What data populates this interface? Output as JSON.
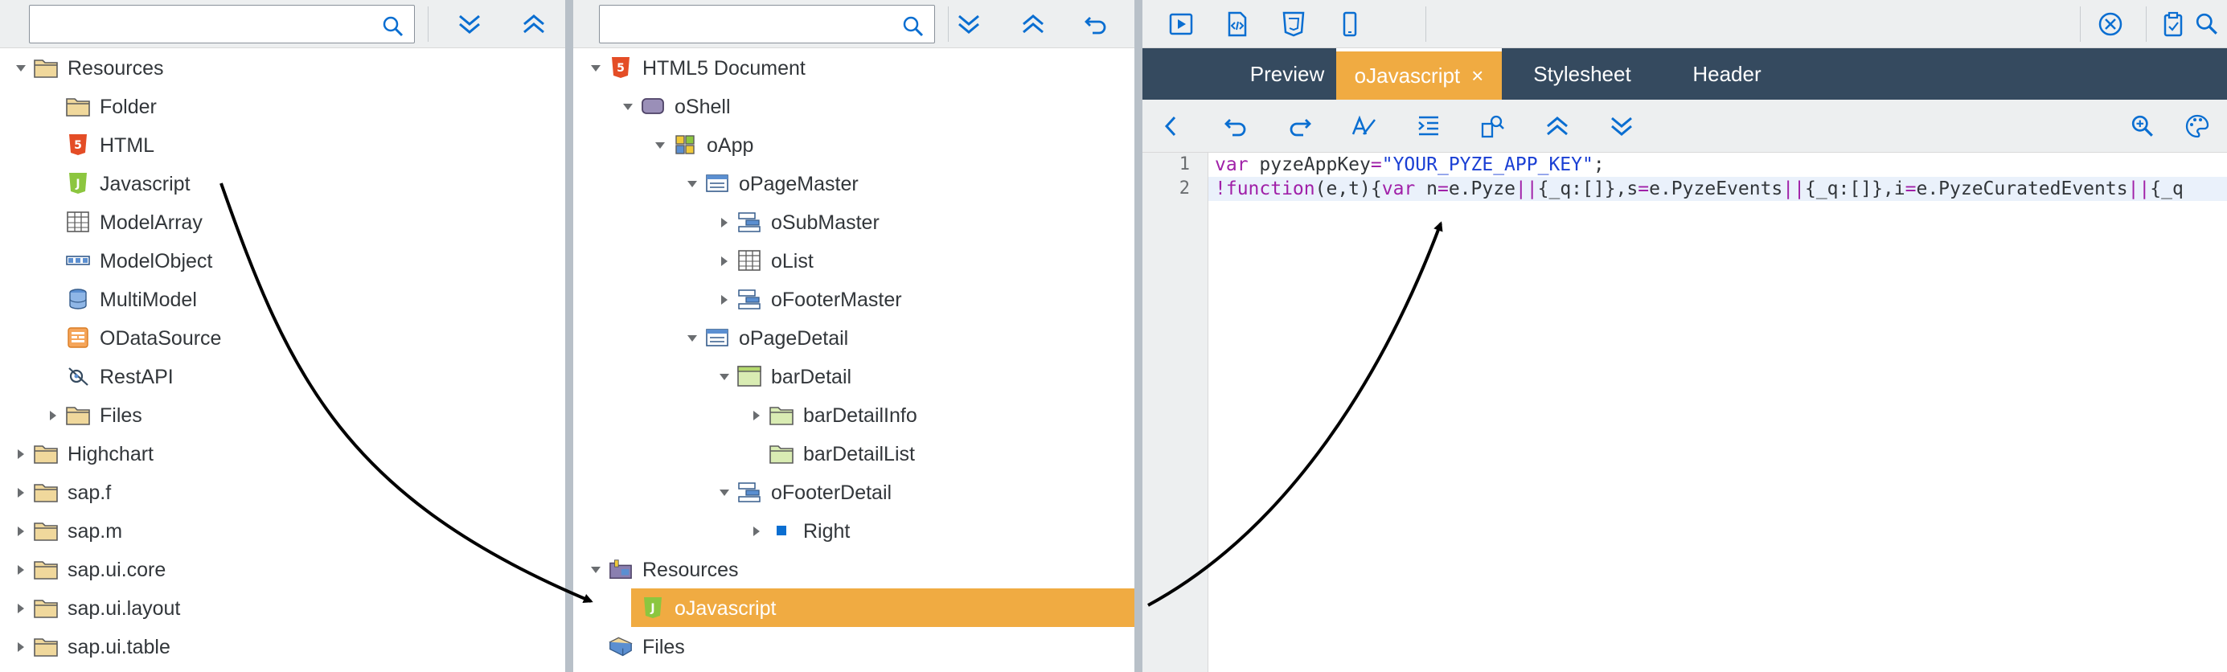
{
  "left_panel": {
    "search": {
      "value": "",
      "placeholder": ""
    },
    "toolbar": {
      "expand_all": "chevrons-down-icon",
      "collapse_all": "chevrons-up-icon"
    },
    "tree": [
      {
        "label": "Resources",
        "icon": "folder-icon",
        "expanded": true
      },
      {
        "label": "Folder",
        "icon": "folder-icon"
      },
      {
        "label": "HTML",
        "icon": "html5-icon"
      },
      {
        "label": "Javascript",
        "icon": "javascript-icon"
      },
      {
        "label": "ModelArray",
        "icon": "table-icon"
      },
      {
        "label": "ModelObject",
        "icon": "object-icon"
      },
      {
        "label": "MultiModel",
        "icon": "database-icon"
      },
      {
        "label": "ODataSource",
        "icon": "odata-icon"
      },
      {
        "label": "RestAPI",
        "icon": "api-icon"
      },
      {
        "label": "Files",
        "icon": "folder-icon",
        "expanded": false
      },
      {
        "label": "Highchart",
        "icon": "folder-icon",
        "expanded": false
      },
      {
        "label": "sap.f",
        "icon": "folder-icon",
        "expanded": false
      },
      {
        "label": "sap.m",
        "icon": "folder-icon",
        "expanded": false
      },
      {
        "label": "sap.ui.core",
        "icon": "folder-icon",
        "expanded": false
      },
      {
        "label": "sap.ui.layout",
        "icon": "folder-icon",
        "expanded": false
      },
      {
        "label": "sap.ui.table",
        "icon": "folder-icon",
        "expanded": false
      }
    ]
  },
  "middle_panel": {
    "search": {
      "value": "",
      "placeholder": ""
    },
    "toolbar": {
      "expand_all": "chevrons-down-icon",
      "collapse_all": "chevrons-up-icon",
      "undo": "undo-icon"
    },
    "tree": [
      {
        "label": "HTML5 Document",
        "icon": "html5-icon",
        "expanded": true
      },
      {
        "label": "oShell",
        "icon": "shell-icon",
        "expanded": true
      },
      {
        "label": "oApp",
        "icon": "app-icon",
        "expanded": true
      },
      {
        "label": "oPageMaster",
        "icon": "page-icon",
        "expanded": true
      },
      {
        "label": "oSubMaster",
        "icon": "bar-icon",
        "expanded": false
      },
      {
        "label": "oList",
        "icon": "table-icon",
        "expanded": false
      },
      {
        "label": "oFooterMaster",
        "icon": "bar-icon",
        "expanded": false
      },
      {
        "label": "oPageDetail",
        "icon": "page-icon",
        "expanded": true
      },
      {
        "label": "barDetail",
        "icon": "panel-icon",
        "expanded": true
      },
      {
        "label": "barDetailInfo",
        "icon": "folder-green-icon",
        "expanded": false
      },
      {
        "label": "barDetailList",
        "icon": "folder-green-icon"
      },
      {
        "label": "oFooterDetail",
        "icon": "bar-icon",
        "expanded": true
      },
      {
        "label": "Right",
        "icon": "square-icon",
        "expanded": false
      },
      {
        "label": "Resources",
        "icon": "resources-icon",
        "expanded": true
      },
      {
        "label": "oJavascript",
        "icon": "javascript-icon",
        "selected": true
      },
      {
        "label": "Files",
        "icon": "files-icon"
      }
    ]
  },
  "right_panel": {
    "toolbar": {
      "run": "play-icon",
      "code": "code-file-icon",
      "css": "css3-icon",
      "mobile": "mobile-icon",
      "close": "close-circle-icon",
      "clipboard": "clipboard-icon",
      "search": "search-icon"
    },
    "tabs": [
      {
        "label": "Preview",
        "active": false
      },
      {
        "label": "oJavascript",
        "active": true,
        "close": "×"
      },
      {
        "label": "Stylesheet",
        "active": false
      },
      {
        "label": "Header",
        "active": false
      }
    ],
    "editor_toolbar": {
      "back": "chevron-left-icon",
      "undo": "undo-icon",
      "redo": "redo-icon",
      "spellcheck": "spellcheck-icon",
      "indent": "indent-icon",
      "find": "find-icon",
      "fold_up": "chevrons-up-icon",
      "fold_down": "chevrons-down-icon",
      "zoom": "zoom-in-icon",
      "theme": "palette-icon"
    },
    "code": {
      "line_numbers": [
        "1",
        "2"
      ],
      "line1": {
        "kw": "var",
        "ident": " pyzeAppKey",
        "op": "=",
        "str": "\"YOUR_PYZE_APP_KEY\"",
        "end": ";"
      },
      "line2_segments": [
        {
          "t": "!function",
          "c": "kw"
        },
        {
          "t": "(e,t){",
          "c": ""
        },
        {
          "t": "var",
          "c": "kw"
        },
        {
          "t": " n",
          "c": ""
        },
        {
          "t": "=",
          "c": "op"
        },
        {
          "t": "e.Pyze",
          "c": ""
        },
        {
          "t": "||",
          "c": "op"
        },
        {
          "t": "{_q:[]},s",
          "c": ""
        },
        {
          "t": "=",
          "c": "op"
        },
        {
          "t": "e.PyzeEvents",
          "c": ""
        },
        {
          "t": "||",
          "c": "op"
        },
        {
          "t": "{_q:[]},i",
          "c": ""
        },
        {
          "t": "=",
          "c": "op"
        },
        {
          "t": "e.PyzeCuratedEvents",
          "c": ""
        },
        {
          "t": "||",
          "c": "op"
        },
        {
          "t": "{_q",
          "c": ""
        }
      ]
    }
  },
  "colors": {
    "accent": "#f0ab42",
    "shell": "#354a5f",
    "toolbar": "#edeff0",
    "icon": "#0a6ed1"
  }
}
